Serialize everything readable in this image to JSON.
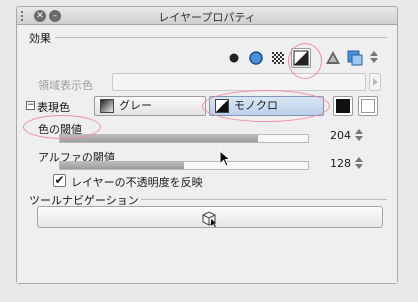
{
  "window": {
    "title": "レイヤープロパティ"
  },
  "effects": {
    "label": "効果",
    "area_color_label": "領域表示色"
  },
  "expression": {
    "label": "表現色",
    "options": [
      "グレー",
      "モノクロ"
    ],
    "selected": "モノクロ"
  },
  "threshold": {
    "label": "色の閾値",
    "value": 204,
    "max": 255
  },
  "alpha_threshold": {
    "label": "アルファの閾値",
    "value": 128,
    "max": 255
  },
  "reflect_opacity": {
    "label": "レイヤーの不透明度を反映",
    "checked": true,
    "check_glyph": "✔"
  },
  "tool_navigation": {
    "label": "ツールナビゲーション"
  },
  "colors": {
    "highlight_ring": "#ef8fa7",
    "accent": "#4a90d9"
  },
  "titlebar_buttons": {
    "close_glyph": "✕",
    "minimize_glyph": "–"
  },
  "collapse_glyph": "−"
}
